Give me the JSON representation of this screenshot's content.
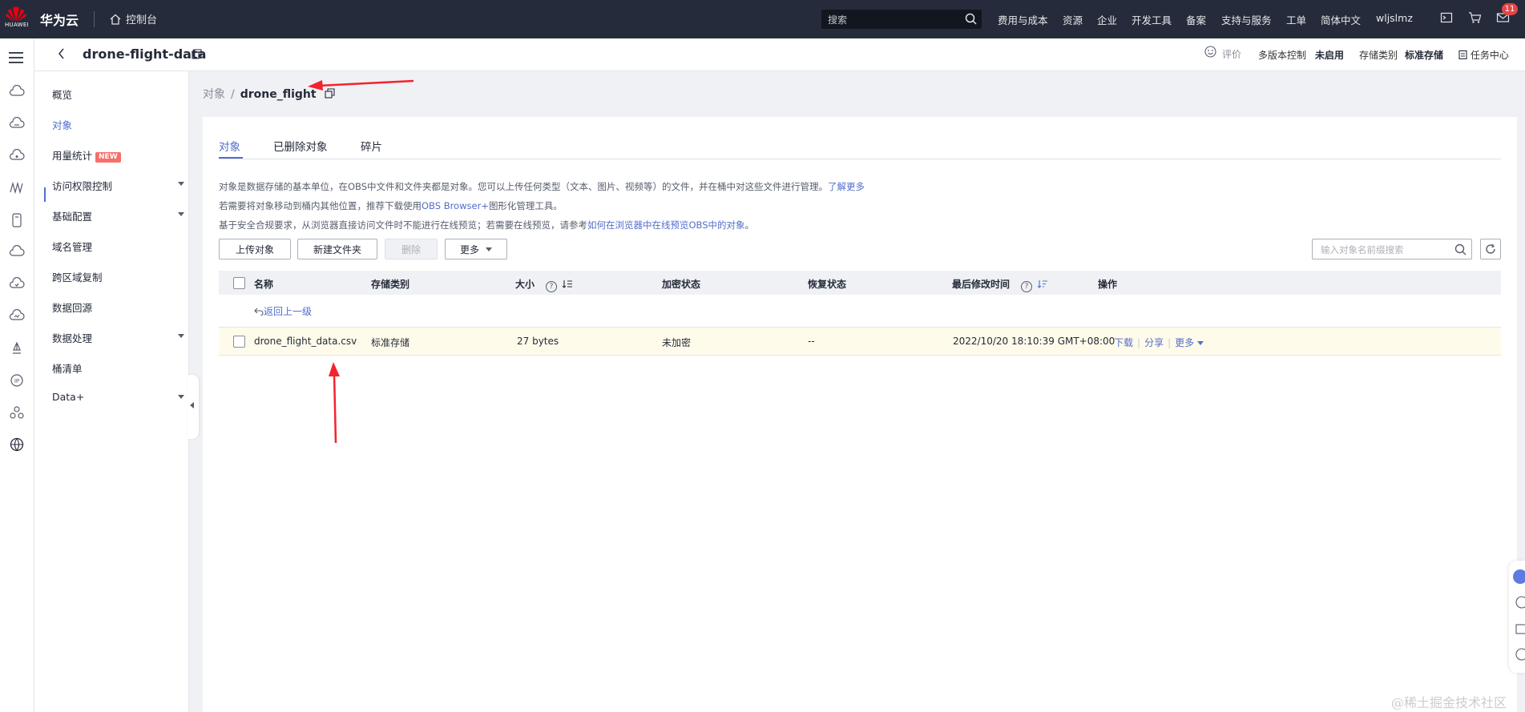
{
  "topbar": {
    "logo_text": "HUAWEI",
    "brand": "华为云",
    "console": "控制台",
    "search_placeholder": "搜索",
    "nav": [
      "费用与成本",
      "资源",
      "企业",
      "开发工具",
      "备案",
      "支持与服务",
      "工单",
      "简体中文",
      "wljslmz"
    ],
    "mail_badge": "11"
  },
  "bucket_header": {
    "bucket_name": "drone-flight-data",
    "rate": "评价",
    "versioning_label": "多版本控制",
    "versioning_value": "未启用",
    "storage_label": "存储类别",
    "storage_value": "标准存储",
    "task_center": "任务中心"
  },
  "sidenav": {
    "items": [
      {
        "label": "概览"
      },
      {
        "label": "对象",
        "active": true
      },
      {
        "label": "用量统计",
        "tag": "NEW"
      },
      {
        "label": "访问权限控制",
        "expandable": true
      },
      {
        "label": "基础配置",
        "expandable": true
      },
      {
        "label": "域名管理"
      },
      {
        "label": "跨区域复制"
      },
      {
        "label": "数据回源"
      },
      {
        "label": "数据处理",
        "expandable": true
      },
      {
        "label": "桶清单"
      },
      {
        "label": "Data+",
        "expandable": true
      }
    ]
  },
  "breadcrumb": {
    "root": "对象",
    "separator": "/",
    "current": "drone_flight"
  },
  "tabs": [
    "对象",
    "已删除对象",
    "碎片"
  ],
  "info": {
    "line1": "对象是数据存储的基本单位，在OBS中文件和文件夹都是对象。您可以上传任何类型（文本、图片、视频等）的文件，并在桶中对这些文件进行管理。",
    "line1_link": "了解更多",
    "line2_a": "若需要将对象移动到桶内其他位置，推荐下载使用",
    "line2_link": "OBS Browser+",
    "line2_b": "图形化管理工具。",
    "line3": "基于安全合规要求，从浏览器直接访问文件时不能进行在线预览；若需要在线预览，请参考",
    "line3_link": "如何在浏览器中在线预览OBS中的对象",
    "line3_end": "。"
  },
  "toolbar": {
    "upload": "上传对象",
    "new_folder": "新建文件夹",
    "delete": "删除",
    "more": "更多",
    "search_placeholder": "输入对象名前缀搜索"
  },
  "table": {
    "headers": {
      "name": "名称",
      "storage_class": "存储类别",
      "size": "大小",
      "encryption": "加密状态",
      "restore": "恢复状态",
      "modified": "最后修改时间",
      "actions": "操作"
    },
    "back_link": "返回上一级",
    "rows": [
      {
        "name": "drone_flight_data.csv",
        "storage_class": "标准存储",
        "size": "27 bytes",
        "encryption": "未加密",
        "restore": "--",
        "modified": "2022/10/20 18:10:39 GMT+08:00",
        "actions": [
          "下载",
          "分享",
          "更多"
        ]
      }
    ]
  },
  "watermark": "@稀土掘金技术社区",
  "colors": {
    "topbar": "#252b3a",
    "accent": "#526ecc",
    "highlight_row": "#fffbea",
    "annotation_arrow": "#f5222d"
  }
}
